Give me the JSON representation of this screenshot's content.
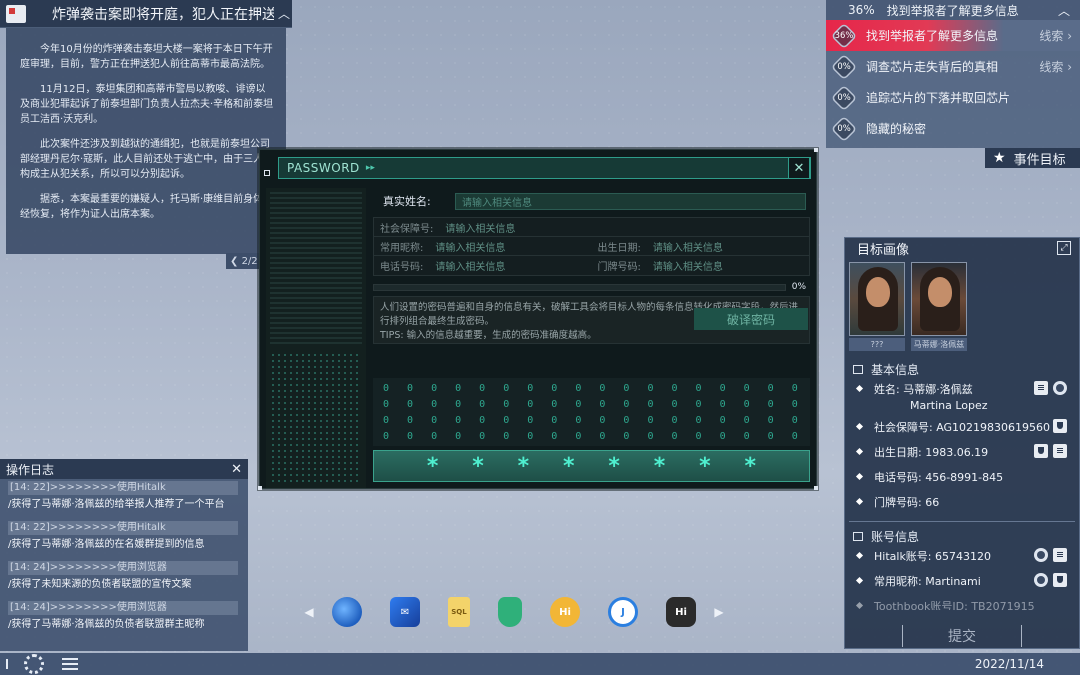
{
  "news": {
    "title": "炸弹袭击案即将开庭，犯人正在押送中",
    "paragraphs": [
      "今年10月份的炸弹袭击泰坦大楼一案将于本日下午开庭审理，目前，警方正在押送犯人前往高蒂市最高法院。",
      "11月12日，泰坦集团和高蒂市警局以教唆、诽谤以及商业犯罪起诉了前泰坦部门负责人拉杰夫·辛格和前泰坦员工洁西·沃克利。",
      "此次案件还涉及到越狱的通缉犯，也就是前泰坦公司部经理丹尼尔·寇斯，此人目前还处于逃亡中，由于三人不构成主从犯关系，所以可以分别起诉。",
      "据悉，本案最重要的嫌疑人，托马斯·康维目前身体已经恢复，将作为证人出席本案。"
    ],
    "pager": "2/2"
  },
  "objectives": {
    "header_pct": "36%",
    "header_text": "找到举报者了解更多信息",
    "items": [
      {
        "pct": "36%",
        "text": "找到举报者了解更多信息",
        "link": "线索",
        "active": true
      },
      {
        "pct": "0%",
        "text": "调查芯片走失背后的真相",
        "link": "线索",
        "active": false
      },
      {
        "pct": "0%",
        "text": "追踪芯片的下落并取回芯片",
        "link": "",
        "active": false
      },
      {
        "pct": "0%",
        "text": "隐藏的秘密",
        "link": "",
        "active": false
      }
    ],
    "tab_label": "事件目标"
  },
  "password": {
    "title": "PASSWORD",
    "name_label": "真实姓名:",
    "name_placeholder": "请输入相关信息",
    "fields": {
      "ssn_label": "社会保障号:",
      "ssn_placeholder": "请输入相关信息",
      "nick_label": "常用昵称:",
      "nick_placeholder": "请输入相关信息",
      "birth_label": "出生日期:",
      "birth_placeholder": "请输入相关信息",
      "phone_label": "电话号码:",
      "phone_placeholder": "请输入相关信息",
      "door_label": "门牌号码:",
      "door_placeholder": "请输入相关信息"
    },
    "progress": "0%",
    "progress_value": 0,
    "desc1": "人们设置的密码普遍和自身的信息有关，破解工具会将目标人物的每条信息转化成密码字段，然后进行排列组合最终生成密码。",
    "desc2": "TIPS: 输入的信息越重要，生成的密码准确度越高。",
    "crack_button": "破译密码",
    "zero_rows": [
      "0 0 0 0 0 0 0 0   0 0 0 0 0 0 0 0   0 0 0 0 0 0 0 0   0 0 0 0 0 0 0 0",
      "0 0 0 0 0 0 0 0   0 0 0 0 0 0 0 0   0 0 0 0 0 0 0 0   0 0 0 0 0 0 0 0",
      "0 0 0 0 0 0 0 0   0 0 0 0 0 0 0 0   0 0 0 0 0 0 0 0   0 0 0 0 0 0 0 0",
      "0 0 0 0 0 0 0 0   0 0 0 0 0 0 0 0   0 0 0 0 0 0 0 0   0 0 0 0 0 0 0 0"
    ],
    "stars": [
      "*",
      "*",
      "*",
      "*",
      "*",
      "*",
      "*",
      "*"
    ]
  },
  "target": {
    "title": "目标画像",
    "portraits": [
      {
        "caption": "???"
      },
      {
        "caption": "马蒂娜·洛佩兹"
      }
    ],
    "basic_title": "基本信息",
    "name_label": "姓名:",
    "name_value": "马蒂娜·洛佩兹",
    "name_en": "Martina Lopez",
    "ssn": "社会保障号: AG10219830619560",
    "birth": "出生日期: 1983.06.19",
    "phone": "电话号码: 456-8991-845",
    "door": "门牌号码: 66",
    "account_title": "账号信息",
    "hitalk": "Hitalk账号: 65743120",
    "nick": "常用昵称: Martinami",
    "truncated": "Toothbook账号ID: TB2071915",
    "submit": "提交"
  },
  "log": {
    "title": "操作日志",
    "entries": [
      {
        "ts": "[14: 22]>>>>>>>>使用Hitalk",
        "msg": "/获得了马蒂娜·洛佩兹的给举报人推荐了一个平台"
      },
      {
        "ts": "[14: 22]>>>>>>>>使用Hitalk",
        "msg": "/获得了马蒂娜·洛佩兹的在名媛群提到的信息"
      },
      {
        "ts": "[14: 24]>>>>>>>>使用浏览器",
        "msg": "/获得了未知来源的负债者联盟的宣传文案"
      },
      {
        "ts": "[14: 24]>>>>>>>>使用浏览器",
        "msg": "/获得了马蒂娜·洛佩兹的负债者联盟群主昵称"
      }
    ]
  },
  "dock": {
    "apps": [
      {
        "name": "browser-app-icon",
        "glyph": ""
      },
      {
        "name": "mail-app-icon",
        "glyph": "✉"
      },
      {
        "name": "sql-app-icon",
        "glyph": "SQL"
      },
      {
        "name": "security-app-icon",
        "glyph": ""
      },
      {
        "name": "hitalk-app-icon",
        "glyph": "Hi"
      },
      {
        "name": "hook-app-icon",
        "glyph": "J"
      },
      {
        "name": "hacker-app-icon",
        "glyph": "Hi"
      }
    ]
  },
  "bottombar": {
    "date": "2022/11/14"
  }
}
